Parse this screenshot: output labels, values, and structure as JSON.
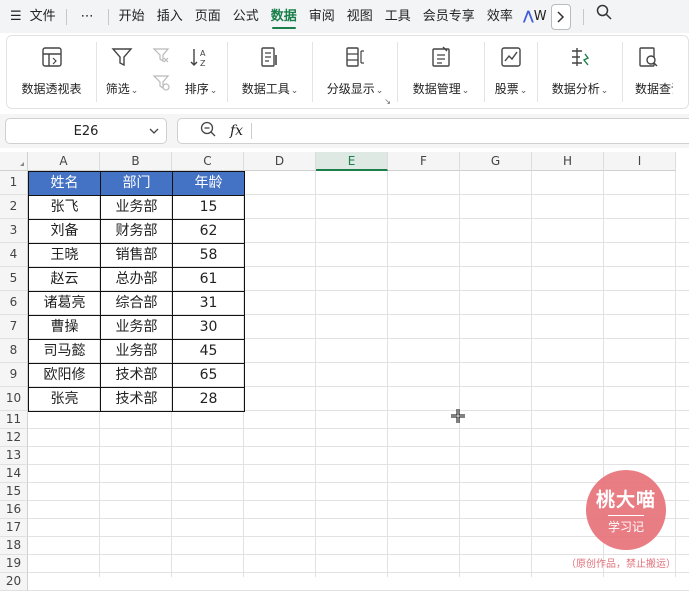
{
  "menubar": {
    "items": [
      "文件",
      "⋯",
      "开始",
      "插入",
      "页面",
      "公式",
      "数据",
      "审阅",
      "视图",
      "工具",
      "会员专享",
      "效率",
      "W"
    ],
    "active_index": 6,
    "active_color": "#1a7f4b"
  },
  "ribbon": {
    "groups": [
      {
        "label": "数据透视表",
        "icon": "pivot-table-icon",
        "has_caret": false
      },
      {
        "label": "筛选",
        "icon": "filter-icon",
        "has_caret": true
      },
      {
        "label": "排序",
        "icon": "sort-icon",
        "has_caret": true
      },
      {
        "label": "数据工具",
        "icon": "data-tools-icon",
        "has_caret": true
      },
      {
        "label": "分级显示",
        "icon": "outline-icon",
        "has_caret": true
      },
      {
        "label": "数据管理",
        "icon": "data-management-icon",
        "has_caret": true
      },
      {
        "label": "股票",
        "icon": "stock-icon",
        "has_caret": true
      },
      {
        "label": "数据分析",
        "icon": "data-analysis-icon",
        "has_caret": true
      },
      {
        "label": "数据查询",
        "icon": "data-query-icon",
        "has_caret": false
      }
    ]
  },
  "formula_bar": {
    "name_box": "E26",
    "fx_label": "fx",
    "value": ""
  },
  "sheet": {
    "columns": [
      "A",
      "B",
      "C",
      "D",
      "E",
      "F",
      "G",
      "H",
      "I"
    ],
    "selected_column": "E",
    "rows": [
      "1",
      "2",
      "3",
      "4",
      "5",
      "6",
      "7",
      "8",
      "9",
      "10",
      "11",
      "12",
      "13",
      "14",
      "15",
      "16",
      "17",
      "18",
      "19",
      "20"
    ],
    "header_fill": "#4472c4",
    "table_header": [
      "姓名",
      "部门",
      "年龄"
    ],
    "table_rows": [
      [
        "张飞",
        "业务部",
        "15"
      ],
      [
        "刘备",
        "财务部",
        "62"
      ],
      [
        "王晓",
        "销售部",
        "58"
      ],
      [
        "赵云",
        "总办部",
        "61"
      ],
      [
        "诸葛亮",
        "综合部",
        "31"
      ],
      [
        "曹操",
        "业务部",
        "30"
      ],
      [
        "司马懿",
        "业务部",
        "45"
      ],
      [
        "欧阳修",
        "技术部",
        "65"
      ],
      [
        "张亮",
        "技术部",
        "28"
      ]
    ]
  },
  "watermark": {
    "title": "桃大喵",
    "subtitle": "学习记",
    "note": "（原创作品，禁止搬运）",
    "color": "#e8727a"
  }
}
